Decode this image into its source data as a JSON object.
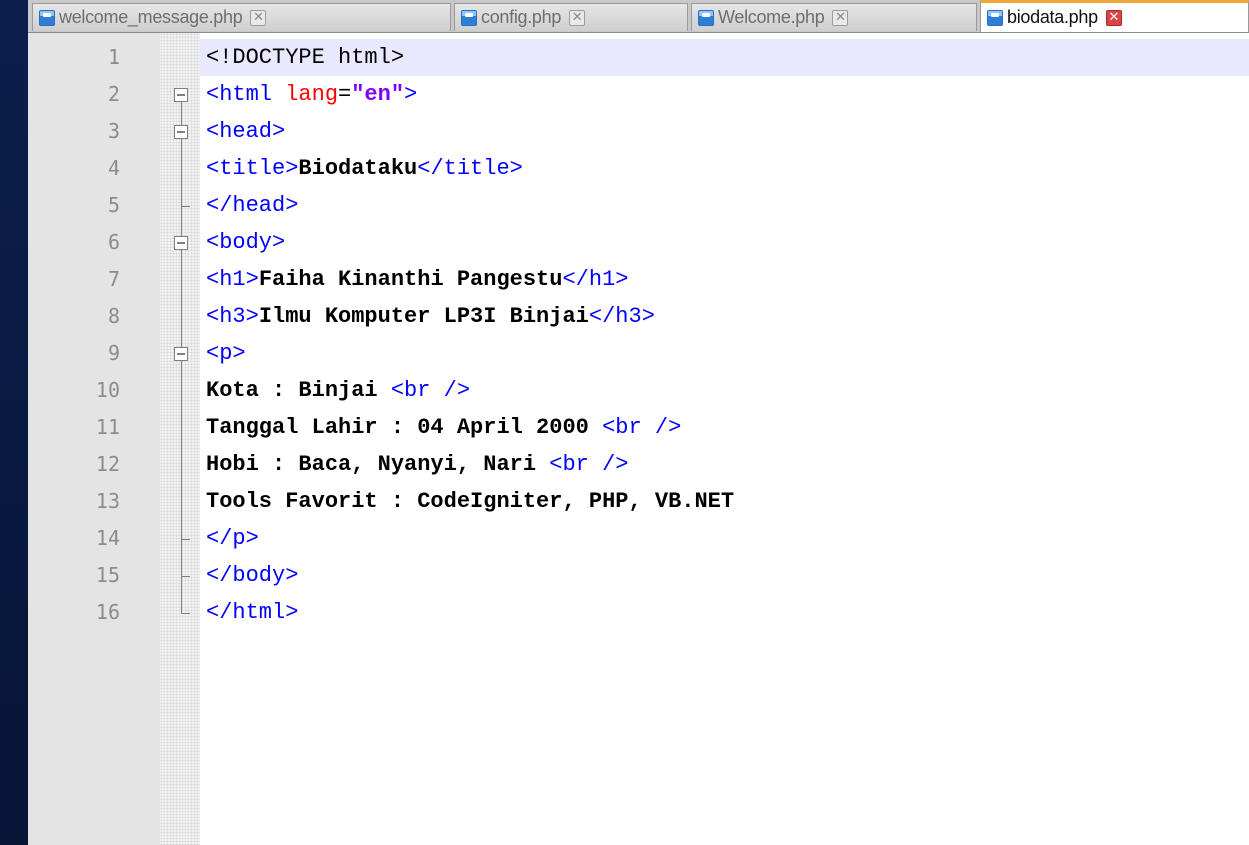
{
  "tabs": [
    {
      "label": "welcome_message.php",
      "active": false
    },
    {
      "label": "config.php",
      "active": false
    },
    {
      "label": "Welcome.php",
      "active": false
    },
    {
      "label": "biodata.php",
      "active": true
    }
  ],
  "tab_close_glyph": "✕",
  "editor": {
    "current_line": 1,
    "lines": [
      {
        "n": "1",
        "text": "<!DOCTYPE html>"
      },
      {
        "n": "2",
        "text": "<html lang=\"en\">"
      },
      {
        "n": "3",
        "text": "<head>"
      },
      {
        "n": "4",
        "text": "<title>Biodataku</title>"
      },
      {
        "n": "5",
        "text": "</head>"
      },
      {
        "n": "6",
        "text": "<body>"
      },
      {
        "n": "7",
        "text": "<h1>Faiha Kinanthi Pangestu</h1>"
      },
      {
        "n": "8",
        "text": "<h3>Ilmu Komputer LP3I Binjai</h3>"
      },
      {
        "n": "9",
        "text": "<p>"
      },
      {
        "n": "10",
        "text": "Kota : Binjai <br />"
      },
      {
        "n": "11",
        "text": "Tanggal Lahir : 04 April 2000 <br />"
      },
      {
        "n": "12",
        "text": "Hobi : Baca, Nyanyi, Nari <br />"
      },
      {
        "n": "13",
        "text": "Tools Favorit : CodeIgniter, PHP, VB.NET"
      },
      {
        "n": "14",
        "text": "</p>"
      },
      {
        "n": "15",
        "text": "</body>"
      },
      {
        "n": "16",
        "text": "</html>"
      }
    ]
  },
  "colors": {
    "tag": "#0000ff",
    "attribute": "#ff0000",
    "string": "#8000ff",
    "text": "#000000",
    "current_line_bg": "#e8e8ff",
    "active_tab_accent": "#f0a63a"
  }
}
